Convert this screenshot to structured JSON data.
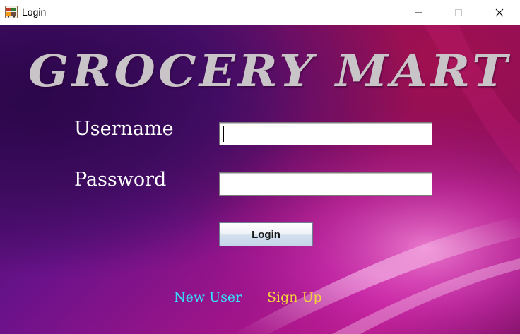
{
  "window": {
    "title": "Login",
    "app_icon": "grocery-cart-icon",
    "controls": {
      "minimize": "minimize-icon",
      "maximize": "maximize-icon",
      "close": "close-icon"
    }
  },
  "form": {
    "app_title": "GROCERY MART",
    "username_label": "Username",
    "username_value": "",
    "password_label": "Password",
    "password_value": "",
    "login_button": "Login"
  },
  "footer": {
    "new_user_text": "New User",
    "sign_up_link": "Sign Up"
  },
  "colors": {
    "title_text": "#c8c4c8",
    "label_text": "#ffffff",
    "new_user_text": "#33e4ff",
    "sign_up_text": "#f5d23a",
    "background_dark": "#3b0b63",
    "background_accent": "#b8178a"
  }
}
